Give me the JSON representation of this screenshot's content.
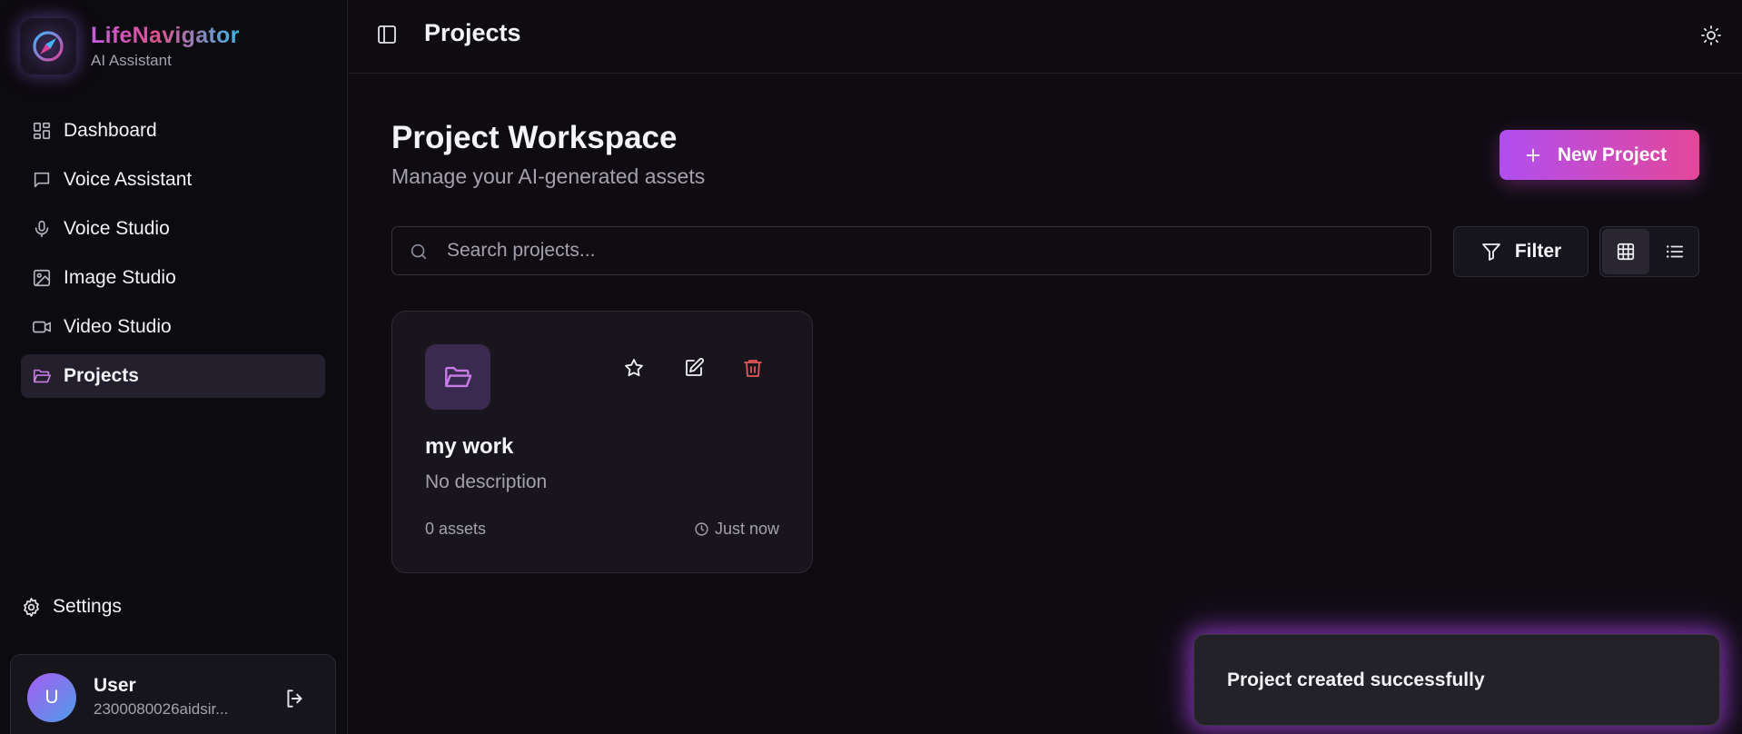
{
  "brand": {
    "name": "LifeNavigator",
    "subtitle": "AI Assistant"
  },
  "sidebar": {
    "items": [
      {
        "label": "Dashboard",
        "icon": "dashboard-icon",
        "active": false
      },
      {
        "label": "Voice Assistant",
        "icon": "message-icon",
        "active": false
      },
      {
        "label": "Voice Studio",
        "icon": "microphone-icon",
        "active": false
      },
      {
        "label": "Image Studio",
        "icon": "image-icon",
        "active": false
      },
      {
        "label": "Video Studio",
        "icon": "video-icon",
        "active": false
      },
      {
        "label": "Projects",
        "icon": "folder-open-icon",
        "active": true
      }
    ],
    "settings_label": "Settings"
  },
  "user": {
    "initial": "U",
    "name": "User",
    "email": "2300080026aidsir..."
  },
  "header": {
    "title": "Projects"
  },
  "main": {
    "title": "Project Workspace",
    "subtitle": "Manage your AI-generated assets",
    "new_button_label": "New Project",
    "search_placeholder": "Search projects...",
    "filter_label": "Filter",
    "view_mode": "grid"
  },
  "projects": [
    {
      "name": "my work",
      "description": "No description",
      "assets": "0 assets",
      "updated": "Just now"
    }
  ],
  "toast": {
    "message": "Project created successfully"
  },
  "colors": {
    "background": "#0e0c11",
    "accent_purple": "#b04ff0",
    "accent_pink": "#e4479a",
    "delete_red": "#e35858",
    "active_icon": "#c77ce6"
  }
}
